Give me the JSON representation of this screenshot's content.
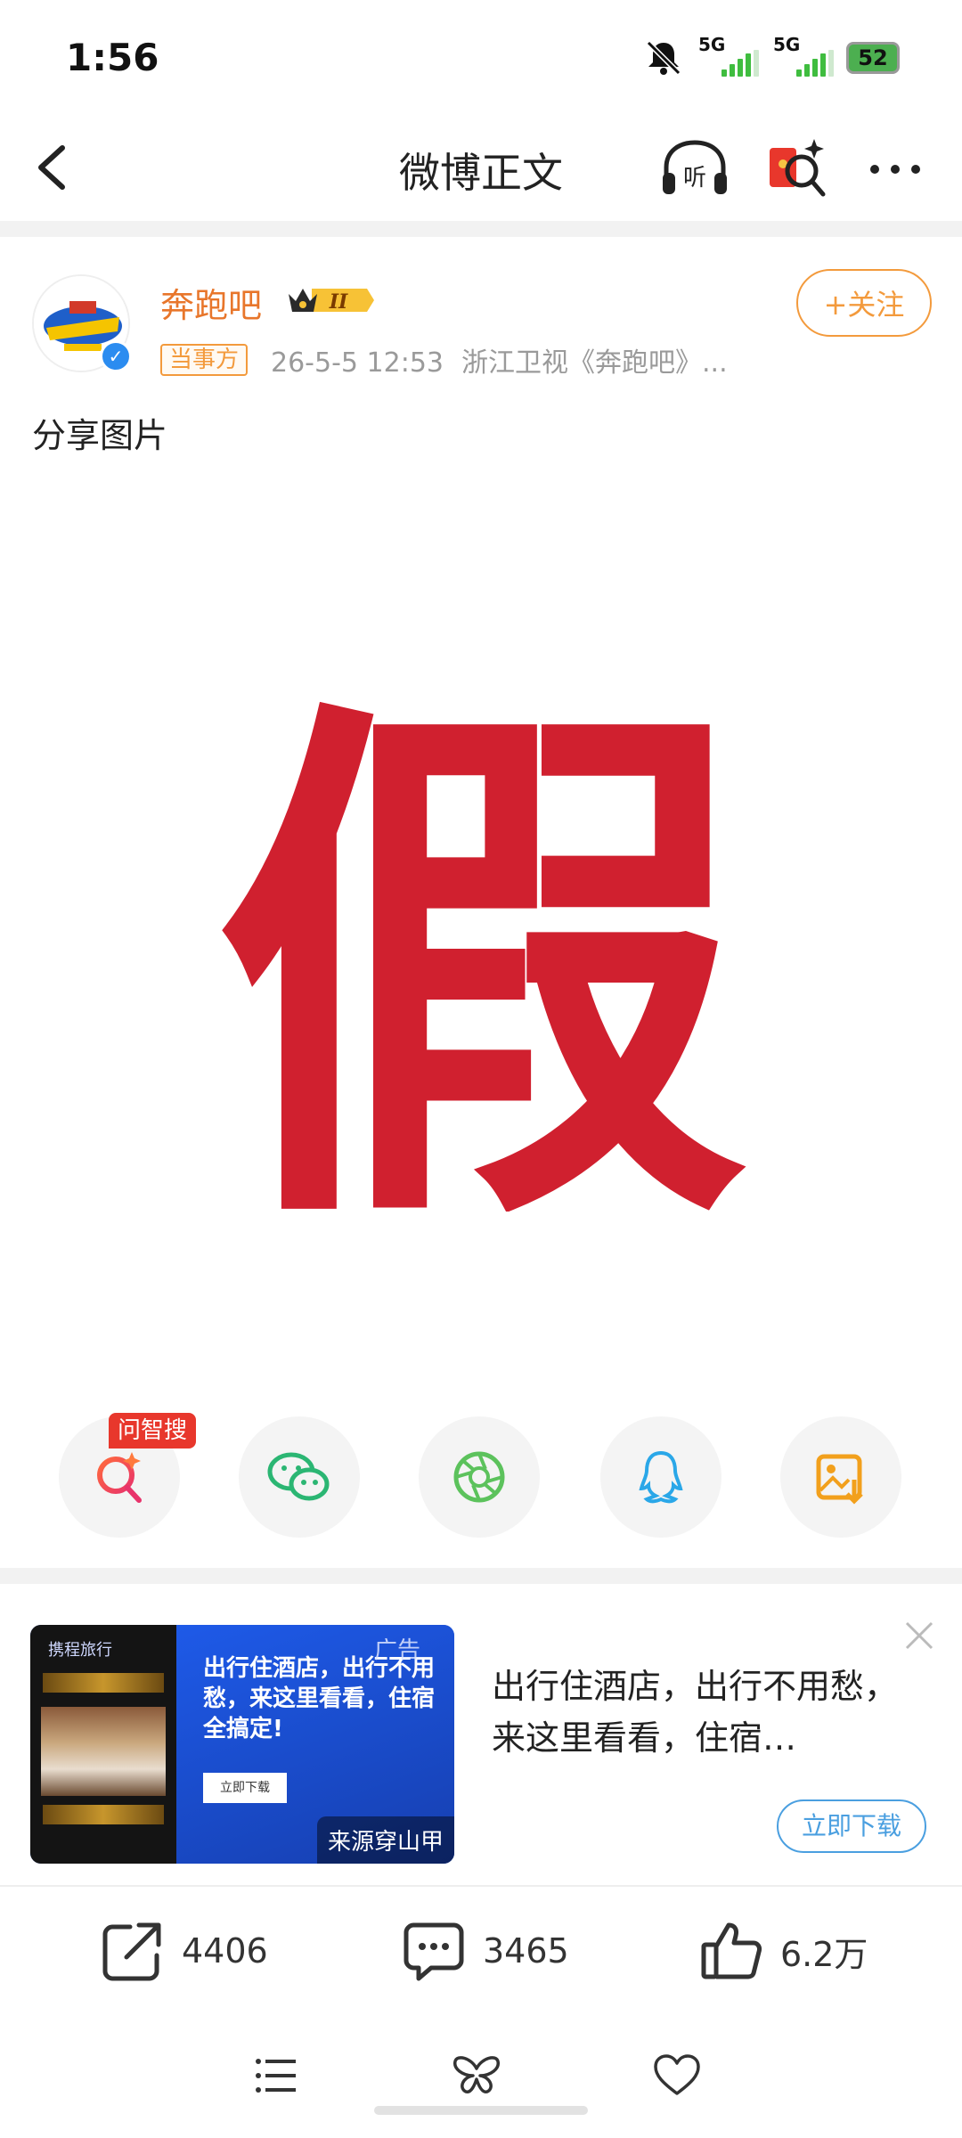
{
  "status_bar": {
    "time": "1:56",
    "signal1_label": "5G",
    "signal2_label": "5G",
    "battery": "52"
  },
  "nav": {
    "title": "微博正文",
    "icons": [
      "back-icon",
      "headphones-listen-icon",
      "red-envelope-ai-icon",
      "more-icon"
    ],
    "listen_label": "听"
  },
  "post": {
    "author": "奔跑吧",
    "role_tag": "当事方",
    "timestamp": "26-5-5 12:53",
    "source": "浙江卫视《奔跑吧》...",
    "follow_label": "+关注",
    "vip_level": "II",
    "text": "分享图片",
    "image_character": "假",
    "image_color": "#d0202f"
  },
  "share": {
    "ai_search_tag": "问智搜",
    "items": [
      "ai-search-icon",
      "wechat-icon",
      "moments-icon",
      "qq-icon",
      "save-image-icon"
    ]
  },
  "ad": {
    "image_brand": "携程旅行",
    "image_slogan": "出行住酒店，出行不用愁，来这里看看，住宿全搞定!",
    "image_button": "立即下载",
    "tag": "广告",
    "source": "来源穿山甲",
    "title": "出行住酒店，出行不用愁，来这里看看，住宿全搞定!",
    "title_display": "出行住酒店，出行不用愁，来这里看看，住宿…",
    "download_label": "立即下载"
  },
  "actions": {
    "reposts": "4406",
    "comments": "3465",
    "likes": "6.2万"
  },
  "colors": {
    "accent_orange": "#f39a3c",
    "author_orange": "#e8762b",
    "download_blue": "#4a9fe0"
  }
}
